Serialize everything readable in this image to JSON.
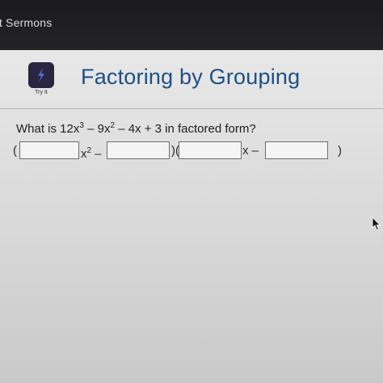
{
  "topbar": {
    "title": "rt Sermons"
  },
  "tryit": {
    "label": "Try It",
    "icon": "lightning-bolt-icon",
    "icon_bg": "#2a2540"
  },
  "main": {
    "heading": "Factoring by Grouping",
    "heading_color": "#1d4f86"
  },
  "question": {
    "p1": "What is 12x",
    "e1": "3",
    "p2": " – 9x",
    "e2": "2",
    "p3": " – 4x + 3 in factored form?"
  },
  "answer": {
    "open_paren_1": "(",
    "var_x": "x",
    "exp_2": "2",
    "minus_1": " –",
    "close_open": ")(",
    "var_x2": "x",
    "minus_2": " –",
    "close_paren_2": ")",
    "inputs": [
      "",
      "",
      "",
      ""
    ]
  }
}
